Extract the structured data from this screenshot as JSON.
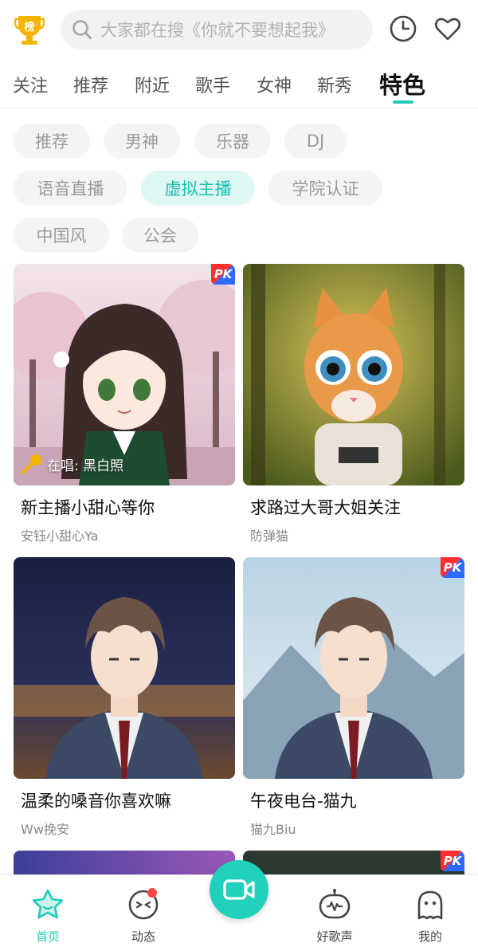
{
  "header": {
    "rank_badge_label": "榜",
    "search_placeholder": "大家都在搜《你就不要想起我》",
    "icons": [
      "search-icon",
      "history-clock-icon",
      "favorite-heart-icon"
    ]
  },
  "tabs": [
    {
      "label": "关注",
      "active": false
    },
    {
      "label": "推荐",
      "active": false
    },
    {
      "label": "附近",
      "active": false
    },
    {
      "label": "歌手",
      "active": false
    },
    {
      "label": "女神",
      "active": false
    },
    {
      "label": "新秀",
      "active": false
    },
    {
      "label": "特色",
      "active": true
    }
  ],
  "chips": [
    {
      "label": "推荐",
      "active": false
    },
    {
      "label": "男神",
      "active": false
    },
    {
      "label": "乐器",
      "active": false
    },
    {
      "label": "DJ",
      "active": false
    },
    {
      "label": "语音直播",
      "active": false
    },
    {
      "label": "虚拟主播",
      "active": true
    },
    {
      "label": "学院认证",
      "active": false
    },
    {
      "label": "中国风",
      "active": false
    },
    {
      "label": "公会",
      "active": false
    }
  ],
  "cards": [
    {
      "title": "新主播小甜心等你",
      "subtitle": "安钰小甜心Ya",
      "pk": true,
      "singing": "在唱: 黑白照"
    },
    {
      "title": "求路过大哥大姐关注",
      "subtitle": "防弹猫",
      "pk": false,
      "singing": ""
    },
    {
      "title": "温柔的嗓音你喜欢嘛",
      "subtitle": "Ww挽安",
      "pk": false,
      "singing": ""
    },
    {
      "title": "午夜电台-猫九",
      "subtitle": "猫九Biu",
      "pk": true,
      "singing": ""
    }
  ],
  "pk_label": "PK",
  "bottom_nav": [
    {
      "label": "首页",
      "icon": "home-star-icon",
      "active": true
    },
    {
      "label": "动态",
      "icon": "feed-face-icon",
      "active": false,
      "badge": true
    },
    {
      "label": "",
      "icon": "live-camera-icon",
      "active": false
    },
    {
      "label": "好歌声",
      "icon": "voice-robot-icon",
      "active": false
    },
    {
      "label": "我的",
      "icon": "profile-ghost-icon",
      "active": false
    }
  ],
  "colors": {
    "accent": "#1ecbb8",
    "badge": "#ff4747",
    "rank_gold": "#f5b400"
  }
}
